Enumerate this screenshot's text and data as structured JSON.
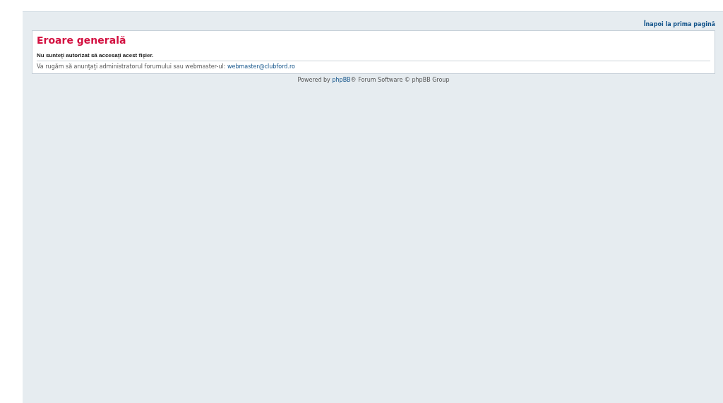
{
  "top_link": "Înapoi la prima pagină",
  "error_panel": {
    "title": "Eroare generală",
    "message": "Nu sunteţi autorizat să accesaţi acest fişier.",
    "note": "Va rugăm să anunţaţi administratorul forumului sau webmaster-ul:",
    "email": "webmaster@clubford.ro"
  },
  "footer": {
    "prefix": "Powered by",
    "link": "phpBB",
    "suffix": "® Forum Software © phpBB Group"
  }
}
